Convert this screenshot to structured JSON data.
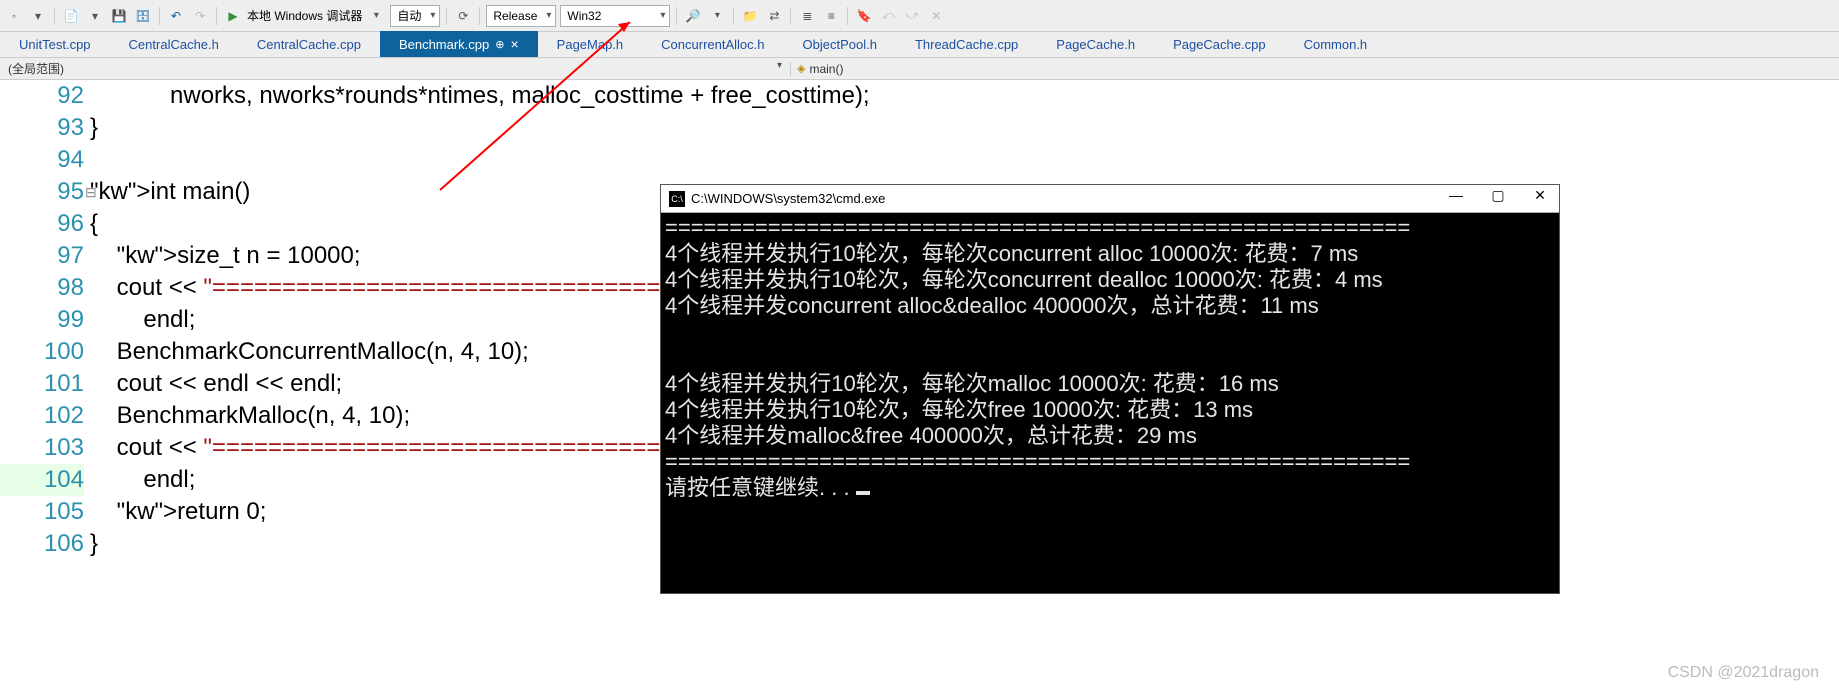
{
  "toolbar": {
    "debugger_label": "本地 Windows 调试器",
    "auto_label": "自动",
    "config_label": "Release",
    "platform_label": "Win32"
  },
  "tabs": [
    {
      "label": "UnitTest.cpp"
    },
    {
      "label": "CentralCache.h"
    },
    {
      "label": "CentralCache.cpp"
    },
    {
      "label": "Benchmark.cpp",
      "active": true
    },
    {
      "label": "PageMap.h"
    },
    {
      "label": "ConcurrentAlloc.h"
    },
    {
      "label": "ObjectPool.h"
    },
    {
      "label": "ThreadCache.cpp"
    },
    {
      "label": "PageCache.h"
    },
    {
      "label": "PageCache.cpp"
    },
    {
      "label": "Common.h"
    }
  ],
  "scopebar": {
    "left": "(全局范围)",
    "right": "main()"
  },
  "code": {
    "line_start": 92,
    "lines": [
      "            nworks, nworks*rounds*ntimes, malloc_costtime + free_costtime);",
      "}",
      "",
      "int main()",
      "{",
      "    size_t n = 10000;",
      "    cout << \"==========================================================\" <<",
      "        endl;",
      "    BenchmarkConcurrentMalloc(n, 4, 10);",
      "    cout << endl << endl;",
      "    BenchmarkMalloc(n, 4, 10);",
      "    cout << \"==========================================================\" <<",
      "        endl;",
      "    return 0;",
      "}"
    ]
  },
  "console": {
    "title": "C:\\WINDOWS\\system32\\cmd.exe",
    "lines": [
      "==========================================================",
      "4个线程并发执行10轮次，每轮次concurrent alloc 10000次: 花费：7 ms",
      "4个线程并发执行10轮次，每轮次concurrent dealloc 10000次: 花费：4 ms",
      "4个线程并发concurrent alloc&dealloc 400000次，总计花费：11 ms",
      "",
      "",
      "4个线程并发执行10轮次，每轮次malloc 10000次: 花费：16 ms",
      "4个线程并发执行10轮次，每轮次free 10000次: 花费：13 ms",
      "4个线程并发malloc&free 400000次，总计花费：29 ms",
      "==========================================================",
      "请按任意键继续. . . "
    ]
  },
  "watermark": "CSDN @2021dragon"
}
